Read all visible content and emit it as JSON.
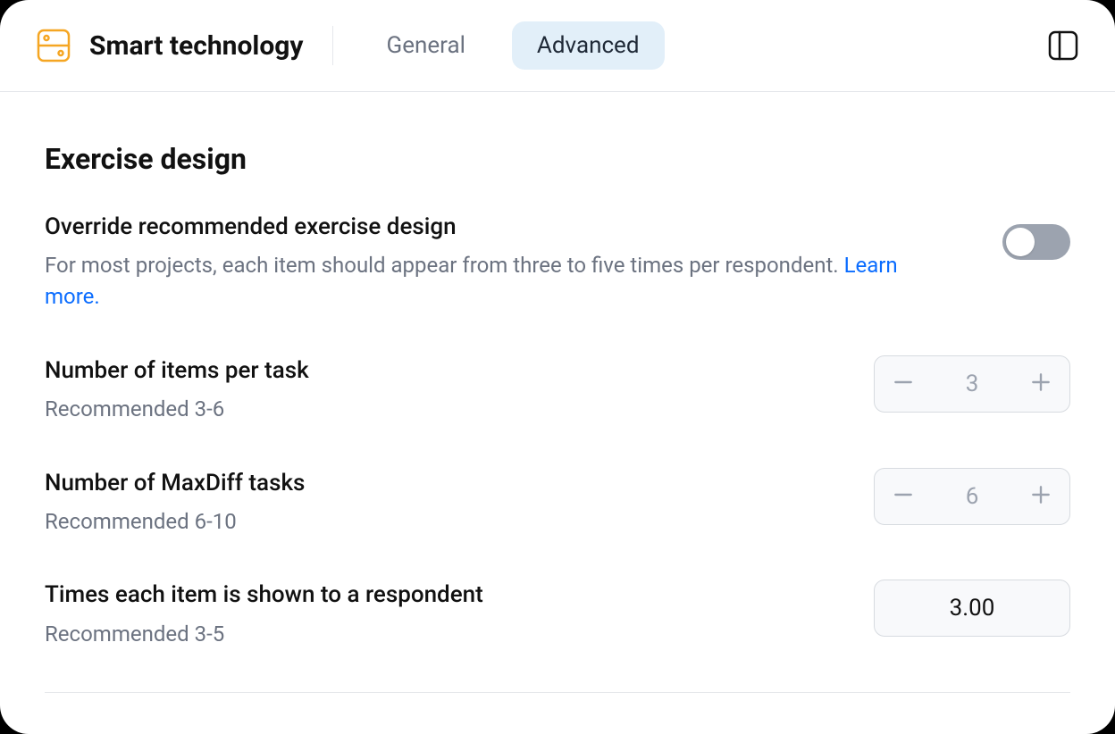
{
  "header": {
    "title": "Smart technology",
    "tabs": {
      "general": "General",
      "advanced": "Advanced"
    }
  },
  "section": {
    "heading": "Exercise design"
  },
  "override": {
    "title": "Override recommended exercise design",
    "sub": "For most projects, each item should appear from three to five times per respondent. ",
    "learn_more": "Learn more.",
    "enabled": false
  },
  "items_per_task": {
    "title": "Number of items per task",
    "sub": "Recommended 3-6",
    "value": "3"
  },
  "maxdiff_tasks": {
    "title": "Number of MaxDiff tasks",
    "sub": "Recommended 6-10",
    "value": "6"
  },
  "times_shown": {
    "title": "Times each item is shown to a respondent",
    "sub": "Recommended 3-5",
    "value": "3.00"
  }
}
